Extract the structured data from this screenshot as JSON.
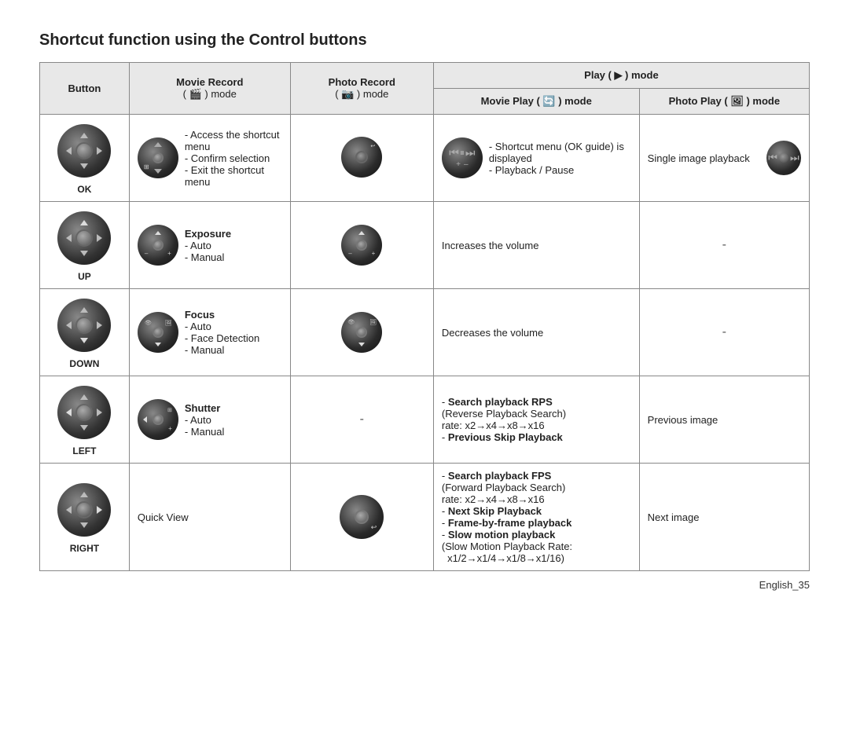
{
  "title": "Shortcut function using the Control buttons",
  "headers": {
    "button": "Button",
    "movie_record": "Movie Record",
    "movie_record_sub": "( 🎬 ) mode",
    "photo_record": "Photo Record",
    "photo_record_sub": "( 📷 ) mode",
    "play_mode": "Play ( ► ) mode",
    "movie_play": "Movie Play ( 🔄 ) mode",
    "photo_play": "Photo Play ( 🖼 ) mode"
  },
  "rows": [
    {
      "button_label": "OK",
      "movie_record_text": "- Access the shortcut menu\n- Confirm selection\n- Exit the shortcut menu",
      "photo_record_text": "",
      "movie_play_text": "- Shortcut menu (OK guide) is displayed\n- Playback / Pause",
      "photo_play_text": "Single image playback"
    },
    {
      "button_label": "UP",
      "movie_record_title": "Exposure",
      "movie_record_text": "- Auto\n- Manual",
      "photo_record_text": "",
      "movie_play_text": "Increases the volume",
      "photo_play_text": "-"
    },
    {
      "button_label": "DOWN",
      "movie_record_title": "Focus",
      "movie_record_text": "- Auto\n- Face Detection\n- Manual",
      "photo_record_text": "",
      "movie_play_text": "Decreases the volume",
      "photo_play_text": "-"
    },
    {
      "button_label": "LEFT",
      "movie_record_title": "Shutter",
      "movie_record_text": "- Auto\n- Manual",
      "photo_record_text": "-",
      "movie_play_text": "- Search playback RPS\n(Reverse Playback Search)\nrate: x2→x4→x8→x16\n- Previous Skip Playback",
      "movie_play_bold": [
        "Search playback RPS",
        "Previous Skip Playback"
      ],
      "photo_play_text": "Previous image"
    },
    {
      "button_label": "RIGHT",
      "movie_record_text": "Quick View",
      "photo_record_text": "",
      "movie_play_text": "- Search playback FPS\n(Forward Playback Search)\nrate: x2→x4→x8→x16\n- Next Skip Playback\n- Frame-by-frame playback\n- Slow motion playback\n(Slow Motion Playback Rate:\n  x1/2→x1/4→x1/8→x1/16)",
      "movie_play_bold": [
        "Search playback FPS",
        "Next Skip Playback",
        "Frame-by-frame playback",
        "Slow motion playback"
      ],
      "photo_play_text": "Next image"
    }
  ],
  "footer": "English_35"
}
